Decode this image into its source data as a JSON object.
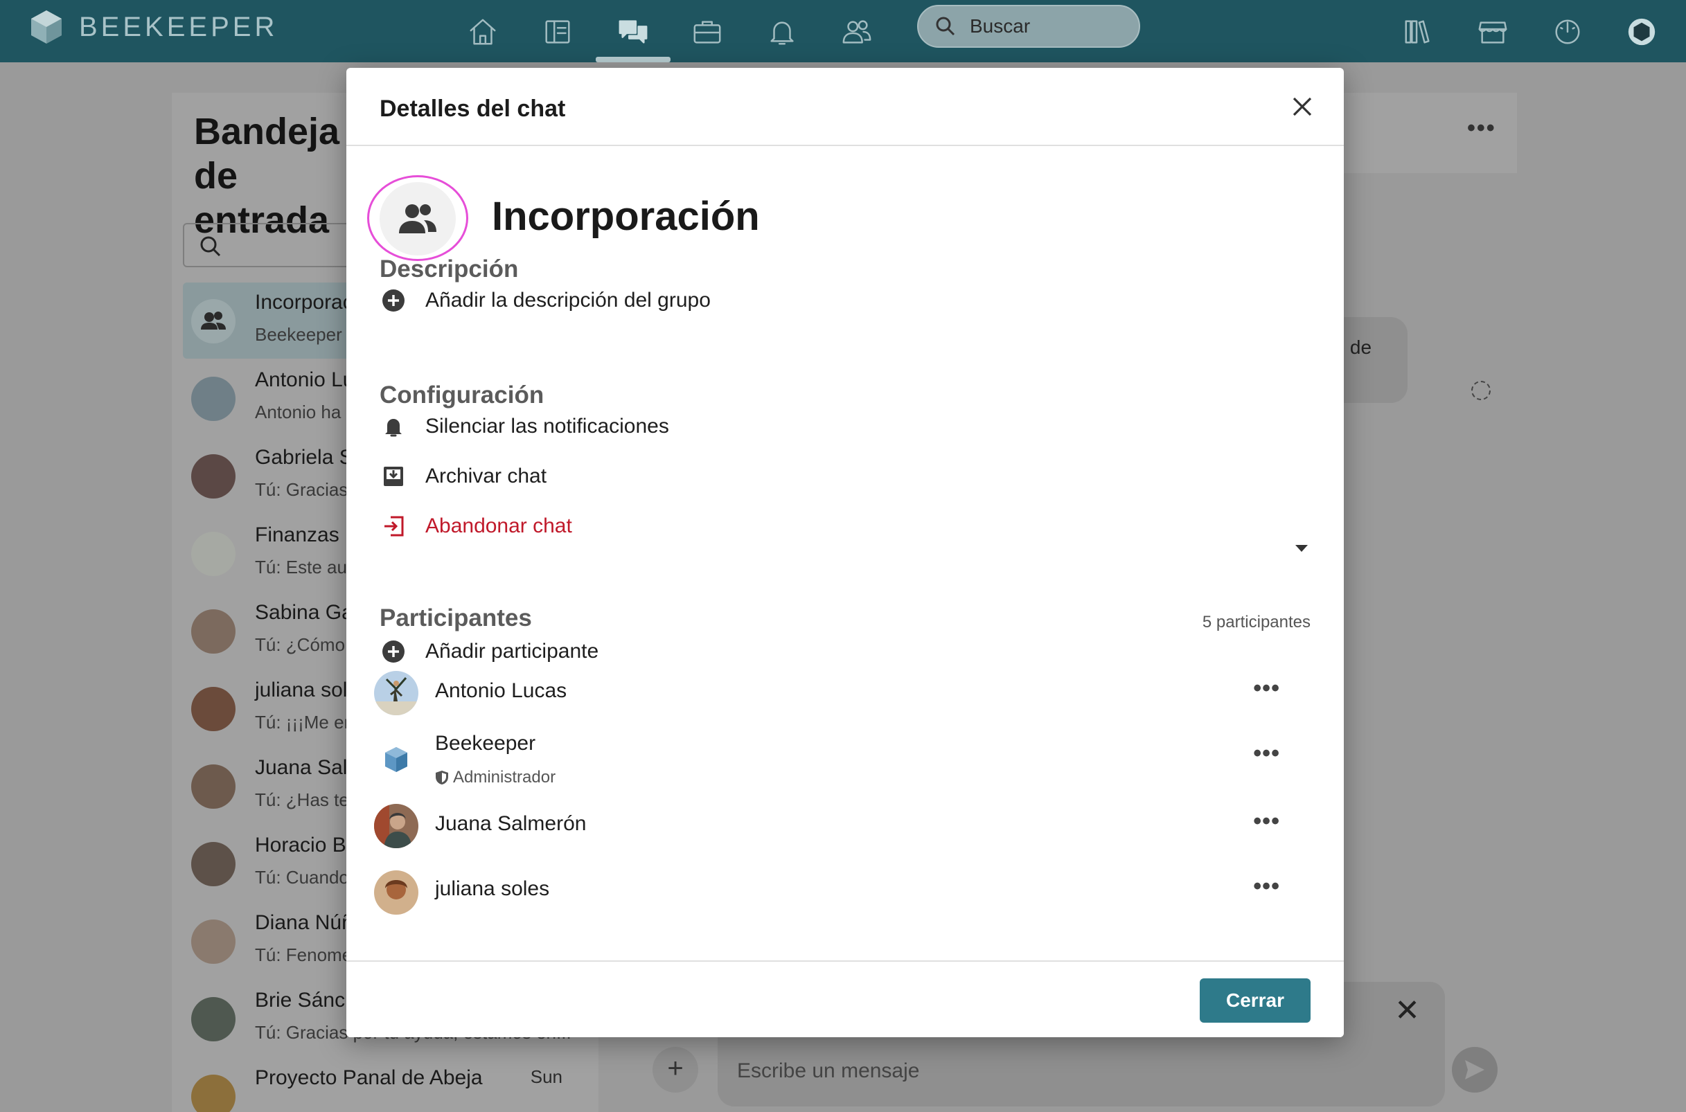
{
  "app": {
    "brand": "BEEKEEPER",
    "colors": {
      "topbar": "#1f5560",
      "accent": "#2e7a8a",
      "danger": "#c0192a",
      "focus_ring": "#e64ed8"
    }
  },
  "topnav": {
    "items": [
      {
        "icon": "home-icon"
      },
      {
        "icon": "news-feed-icon"
      },
      {
        "icon": "chat-icon",
        "active": true
      },
      {
        "icon": "briefcase-icon"
      },
      {
        "icon": "bell-icon"
      },
      {
        "icon": "people-icon"
      }
    ],
    "search_placeholder": "Buscar",
    "right_icons": [
      "library-icon",
      "store-icon",
      "dashboard-icon",
      "profile-avatar-icon"
    ]
  },
  "inbox": {
    "title": "Bandeja de entrada",
    "conversations": [
      {
        "name": "Incorporación",
        "snippet": "Beekeeper ha creado el grupo",
        "selected": true
      },
      {
        "name": "Antonio Lucas",
        "snippet": "Antonio ha enviado un mensaje"
      },
      {
        "name": "Gabriela Sánchez",
        "snippet": "Tú: Gracias de nuevo"
      },
      {
        "name": "Finanzas",
        "snippet": "Tú: Este aumento"
      },
      {
        "name": "Sabina García",
        "snippet": "Tú: ¿Cómo fue?"
      },
      {
        "name": "juliana soles",
        "snippet": "Tú: ¡¡¡Me encanta!!!"
      },
      {
        "name": "Juana Salmerón",
        "snippet": "Tú: ¿Has tenido tiempo?"
      },
      {
        "name": "Horacio Bravo",
        "snippet": "Tú: Cuando tengas un momento"
      },
      {
        "name": "Diana Núñez",
        "snippet": "Tú: Fenomenal"
      },
      {
        "name": "Brie Sánchez",
        "snippet": "Tú: Gracias por tu ayuda, estamos en..."
      },
      {
        "name": "Proyecto Panal de Abeja",
        "snippet": "",
        "time": "Sun"
      }
    ]
  },
  "chat": {
    "more_label": "•••",
    "bubble_text": "eso de",
    "composer_placeholder": "Escribe un mensaje",
    "plus_label": "+",
    "reply_close_label": "✕"
  },
  "modal": {
    "title": "Detalles del chat",
    "group_name": "Incorporación",
    "description": {
      "heading": "Descripción",
      "add_label": "Añadir la descripción del grupo"
    },
    "settings": {
      "heading": "Configuración",
      "mute_label": "Silenciar las notificaciones",
      "archive_label": "Archivar chat",
      "leave_label": "Abandonar chat"
    },
    "participants": {
      "heading": "Participantes",
      "count_label": "5 participantes",
      "add_label": "Añadir participante",
      "more_label": "•••",
      "list": [
        {
          "name": "Antonio Lucas"
        },
        {
          "name": "Beekeeper",
          "role": "Administrador"
        },
        {
          "name": "Juana Salmerón"
        },
        {
          "name": "juliana soles"
        }
      ]
    },
    "close_button": "Cerrar"
  }
}
